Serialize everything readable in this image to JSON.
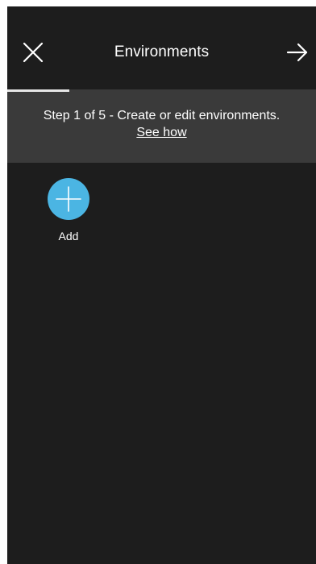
{
  "header": {
    "title": "Environments",
    "close_icon": "close-icon",
    "next_icon": "arrow-right-icon"
  },
  "progress": {
    "current_step": 1,
    "total_steps": 5,
    "fill_fraction": 0.2
  },
  "step_banner": {
    "text": "Step 1 of 5 - Create or edit environments.",
    "link": "See how"
  },
  "tiles": {
    "add": {
      "label": "Add",
      "icon": "plus-icon",
      "color": "#4bb5e3"
    }
  },
  "colors": {
    "background": "#1d1d1d",
    "banner": "#3a3a3a",
    "accent": "#4bb5e3"
  }
}
